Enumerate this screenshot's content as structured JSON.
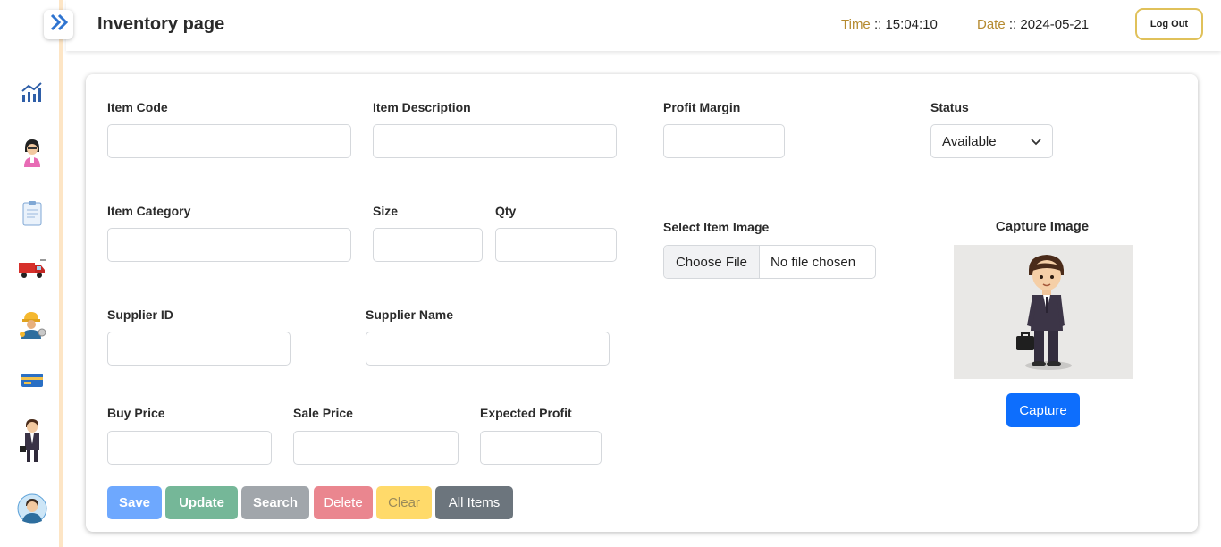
{
  "header": {
    "title": "Inventory page",
    "time_label": "Time",
    "time_sep": "::",
    "time_value": "15:04:10",
    "date_label": "Date",
    "date_sep": "::",
    "date_value": "2024-05-21",
    "logout_label": "Log Out"
  },
  "sidebar": {
    "toggle_icon": "double-chevron-right-icon",
    "items": [
      {
        "icon": "chart-icon"
      },
      {
        "icon": "employee-icon"
      },
      {
        "icon": "clipboard-icon"
      },
      {
        "icon": "truck-icon"
      },
      {
        "icon": "worker-icon"
      },
      {
        "icon": "card-icon"
      },
      {
        "icon": "businessman-icon"
      },
      {
        "icon": "user-avatar-icon"
      }
    ]
  },
  "form": {
    "item_code": {
      "label": "Item Code",
      "value": ""
    },
    "item_description": {
      "label": "Item Description",
      "value": ""
    },
    "profit_margin": {
      "label": "Profit Margin",
      "value": ""
    },
    "status": {
      "label": "Status",
      "value": "Available"
    },
    "item_category": {
      "label": "Item Category",
      "value": ""
    },
    "size": {
      "label": "Size",
      "value": ""
    },
    "qty": {
      "label": "Qty",
      "value": ""
    },
    "select_image": {
      "label": "Select Item Image",
      "button": "Choose File",
      "file": "No file chosen"
    },
    "capture": {
      "label": "Capture Image",
      "button": "Capture"
    },
    "supplier_id": {
      "label": "Supplier ID",
      "value": ""
    },
    "supplier_name": {
      "label": "Supplier Name",
      "value": ""
    },
    "buy_price": {
      "label": "Buy Price",
      "value": ""
    },
    "sale_price": {
      "label": "Sale Price",
      "value": ""
    },
    "expected_profit": {
      "label": "Expected Profit",
      "value": ""
    }
  },
  "actions": {
    "save": "Save",
    "update": "Update",
    "search": "Search",
    "delete": "Delete",
    "clear": "Clear",
    "all_items": "All Items"
  },
  "colors": {
    "primary": "#0d6efd",
    "save": "#6ea8fe",
    "update": "#75b798",
    "search": "#a1a6ab",
    "delete": "#ea868f",
    "clear": "#ffda6a",
    "all_items": "#6c757d",
    "accent": "#b58a2f"
  }
}
